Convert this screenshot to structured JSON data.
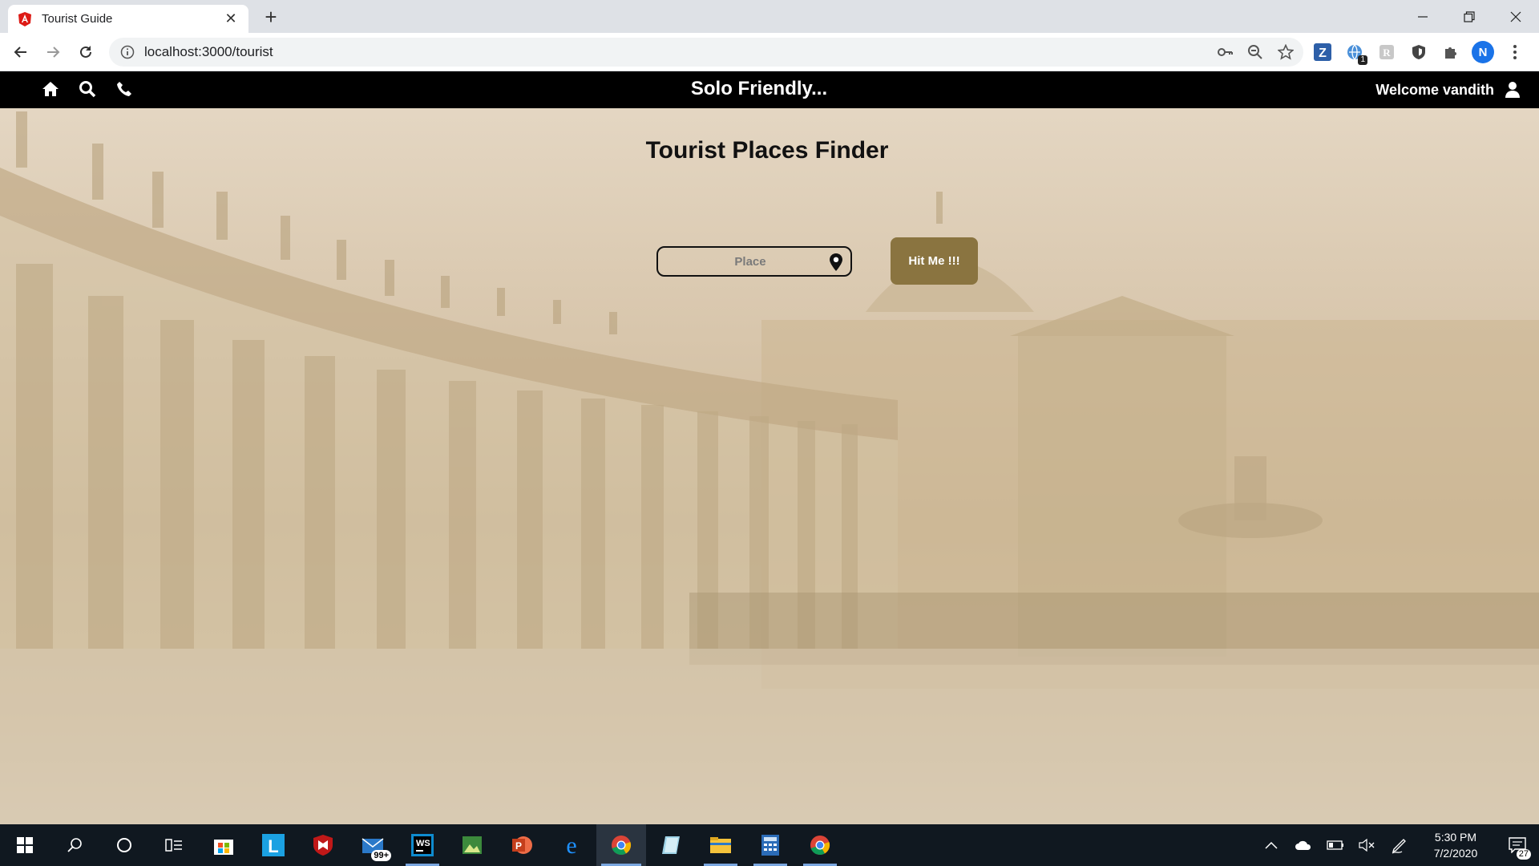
{
  "browser": {
    "tab_title": "Tourist Guide",
    "url": "localhost:3000/tourist",
    "extension_badge": "1",
    "profile_initial": "N"
  },
  "navbar": {
    "brand": "Solo Friendly...",
    "welcome": "Welcome vandith"
  },
  "main": {
    "title": "Tourist Places Finder",
    "place_placeholder": "Place",
    "submit_label": "Hit Me !!!"
  },
  "taskbar": {
    "mail_badge": "99+",
    "time": "5:30 PM",
    "date": "7/2/2020",
    "notification_count": "27"
  },
  "colors": {
    "navbar_bg": "#000000",
    "button_bg": "#8a7440",
    "page_tint": "#d8c6ac"
  }
}
